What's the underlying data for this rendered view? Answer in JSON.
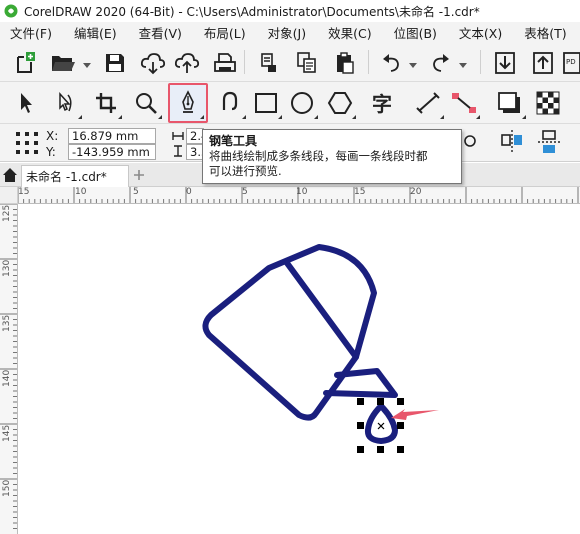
{
  "window": {
    "title": "CorelDRAW 2020 (64-Bit) - C:\\Users\\Administrator\\Documents\\未命名 -1.cdr*"
  },
  "menu": {
    "items": [
      "文件(F)",
      "编辑(E)",
      "查看(V)",
      "布局(L)",
      "对象(J)",
      "效果(C)",
      "位图(B)",
      "文本(X)",
      "表格(T)"
    ]
  },
  "toolbar": {
    "icons": [
      "new-document-icon",
      "open-folder-icon",
      "save-icon",
      "cloud-download-icon",
      "cloud-upload-icon",
      "print-icon",
      "cut-icon",
      "copy-icon",
      "paste-icon",
      "undo-icon",
      "redo-icon",
      "import-icon",
      "export-icon",
      "publish-pdf-icon"
    ]
  },
  "toolbox": {
    "active_tool": "pen",
    "tools": [
      "pick",
      "shape-edit",
      "crop",
      "zoom",
      "pen",
      "artistic-media",
      "rectangle",
      "ellipse",
      "polygon",
      "text",
      "parallel-dimension",
      "connector",
      "drop-shadow",
      "transparency"
    ]
  },
  "propbar": {
    "x_label": "X:",
    "x_value": "16.879 mm",
    "y_label": "Y:",
    "y_value": "-143.959 mm",
    "w_value": "2.4",
    "h_value": "3.3"
  },
  "tooltip": {
    "title": "钢笔工具",
    "line1": "将曲线绘制成多条线段，每画一条线段时都",
    "line2": "可以进行预览."
  },
  "document": {
    "tab_label": "未命名 -1.cdr*"
  },
  "rulers": {
    "h_labels": [
      "15",
      "10",
      "5",
      "0",
      "5",
      "10",
      "15",
      "20"
    ],
    "v_labels": [
      "125",
      "130",
      "135",
      "140",
      "145",
      "150"
    ]
  },
  "colors": {
    "drawing_stroke": "#1a1f7e",
    "accent_red": "#e8566b",
    "selection_handle": "#000000"
  }
}
